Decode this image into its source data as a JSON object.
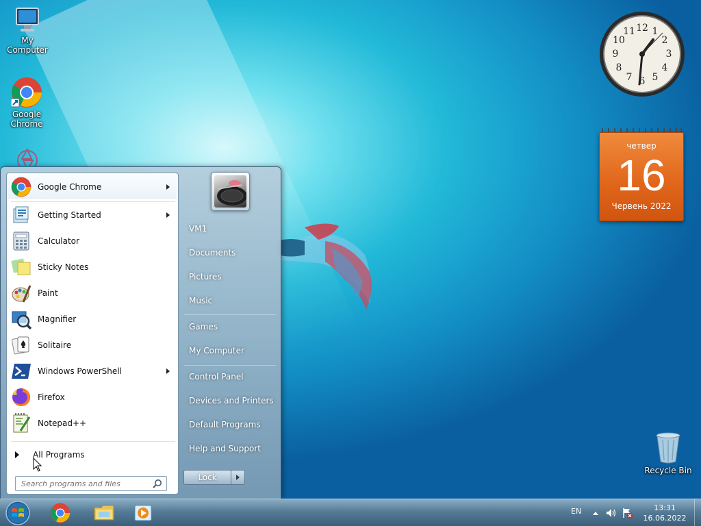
{
  "desktop": {
    "icons": [
      {
        "label": "My Computer"
      },
      {
        "label": "Google Chrome"
      },
      {
        "label": "Recycle Bin"
      }
    ]
  },
  "gadgets": {
    "clock": {
      "numerals": [
        "12",
        "1",
        "2",
        "3",
        "4",
        "5",
        "6",
        "7",
        "8",
        "9",
        "10",
        "11"
      ]
    },
    "calendar": {
      "day_name": "четвер",
      "day_number": "16",
      "month_year": "Червень 2022"
    }
  },
  "start_menu": {
    "programs": [
      {
        "label": "Google Chrome",
        "icon": "chrome-icon",
        "submenu": true
      },
      {
        "label": "Getting Started",
        "icon": "getting-started-icon",
        "submenu": true
      },
      {
        "label": "Calculator",
        "icon": "calculator-icon",
        "submenu": false
      },
      {
        "label": "Sticky Notes",
        "icon": "sticky-notes-icon",
        "submenu": false
      },
      {
        "label": "Paint",
        "icon": "paint-icon",
        "submenu": false
      },
      {
        "label": "Magnifier",
        "icon": "magnifier-icon",
        "submenu": false
      },
      {
        "label": "Solitaire",
        "icon": "solitaire-icon",
        "submenu": false
      },
      {
        "label": "Windows PowerShell",
        "icon": "powershell-icon",
        "submenu": true
      },
      {
        "label": "Firefox",
        "icon": "firefox-icon",
        "submenu": false
      },
      {
        "label": "Notepad++",
        "icon": "notepadpp-icon",
        "submenu": false
      }
    ],
    "all_programs": "All Programs",
    "search_placeholder": "Search programs and files",
    "right_items": [
      {
        "label": "VM1"
      },
      {
        "label": "Documents"
      },
      {
        "label": "Pictures"
      },
      {
        "label": "Music"
      },
      {
        "label": "Games"
      },
      {
        "label": "My Computer"
      },
      {
        "label": "Control Panel"
      },
      {
        "label": "Devices and Printers"
      },
      {
        "label": "Default Programs"
      },
      {
        "label": "Help and Support"
      }
    ],
    "lock_label": "Lock"
  },
  "taskbar": {
    "language": "EN",
    "time": "13:31",
    "date": "16.06.2022"
  },
  "colors": {
    "accent_orange": "#e0651a",
    "taskbar": "#5a7d96"
  }
}
